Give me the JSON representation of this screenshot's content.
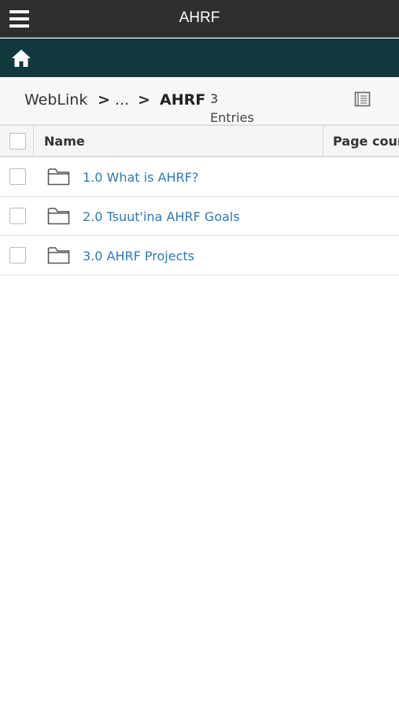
{
  "header": {
    "title": "AHRF",
    "menu_icon": "hamburger-menu-icon"
  },
  "nav": {
    "home_icon": "home-icon"
  },
  "breadcrumb": {
    "root": "WebLink",
    "ellipsis": "...",
    "current": "AHRF",
    "separator": ">"
  },
  "entries": {
    "count": "3",
    "label": "Entries"
  },
  "colors": {
    "topbar": "#2f2f2f",
    "navbar": "#10383d",
    "link": "#2a7ab8"
  },
  "table": {
    "columns": [
      "Name",
      "Page count"
    ],
    "rows": [
      {
        "name": "1.0 What is AHRF?",
        "icon": "folder-icon"
      },
      {
        "name": "2.0 Tsuut'ina AHRF Goals",
        "icon": "folder-icon"
      },
      {
        "name": "3.0 AHRF Projects",
        "icon": "folder-icon"
      }
    ]
  }
}
